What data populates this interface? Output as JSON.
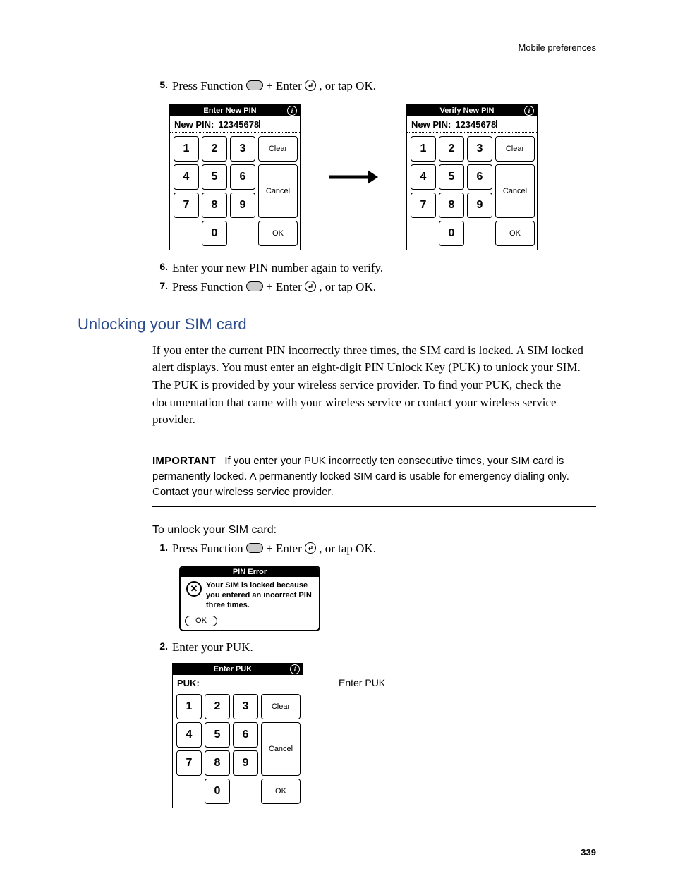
{
  "header": {
    "section": "Mobile preferences"
  },
  "steps_a": [
    {
      "num": "5.",
      "pre": "Press Function ",
      "mid": " + Enter ",
      "post": ", or tap OK."
    },
    {
      "num": "6.",
      "text": "Enter your new PIN number again to verify."
    },
    {
      "num": "7.",
      "pre": "Press Function ",
      "mid": " + Enter ",
      "post": ", or tap OK."
    }
  ],
  "keypads": {
    "enter": {
      "title": "Enter New PIN",
      "label": "New PIN:",
      "value": "12345678"
    },
    "verify": {
      "title": "Verify New PIN",
      "label": "New PIN:",
      "value": "12345678"
    },
    "puk": {
      "title": "Enter PUK",
      "label": "PUK:",
      "value": ""
    },
    "keys": [
      "1",
      "2",
      "3",
      "4",
      "5",
      "6",
      "7",
      "8",
      "9",
      "0"
    ],
    "clear": "Clear",
    "cancel": "Cancel",
    "ok": "OK"
  },
  "heading": "Unlocking your SIM card",
  "para": "If you enter the current PIN incorrectly three times, the SIM card is locked. A SIM locked alert displays. You must enter an eight-digit PIN Unlock Key (PUK) to unlock your SIM. The PUK is provided by your wireless service provider. To find your PUK, check the documentation that came with your wireless service or contact your wireless service provider.",
  "important": {
    "label": "IMPORTANT",
    "text": "If you enter your PUK incorrectly ten consecutive times, your SIM card is permanently locked. A permanently locked SIM card is usable for emergency dialing only. Contact your wireless service provider."
  },
  "subhead": "To unlock your SIM card:",
  "steps_b": [
    {
      "num": "1.",
      "pre": "Press Function ",
      "mid": " + Enter ",
      "post": ", or tap OK."
    },
    {
      "num": "2.",
      "text": "Enter your PUK."
    }
  ],
  "error": {
    "title": "PIN Error",
    "text": "Your SIM is locked because you entered an incorrect PIN three times.",
    "ok": "OK"
  },
  "callout": "Enter PUK",
  "page_number": "339"
}
